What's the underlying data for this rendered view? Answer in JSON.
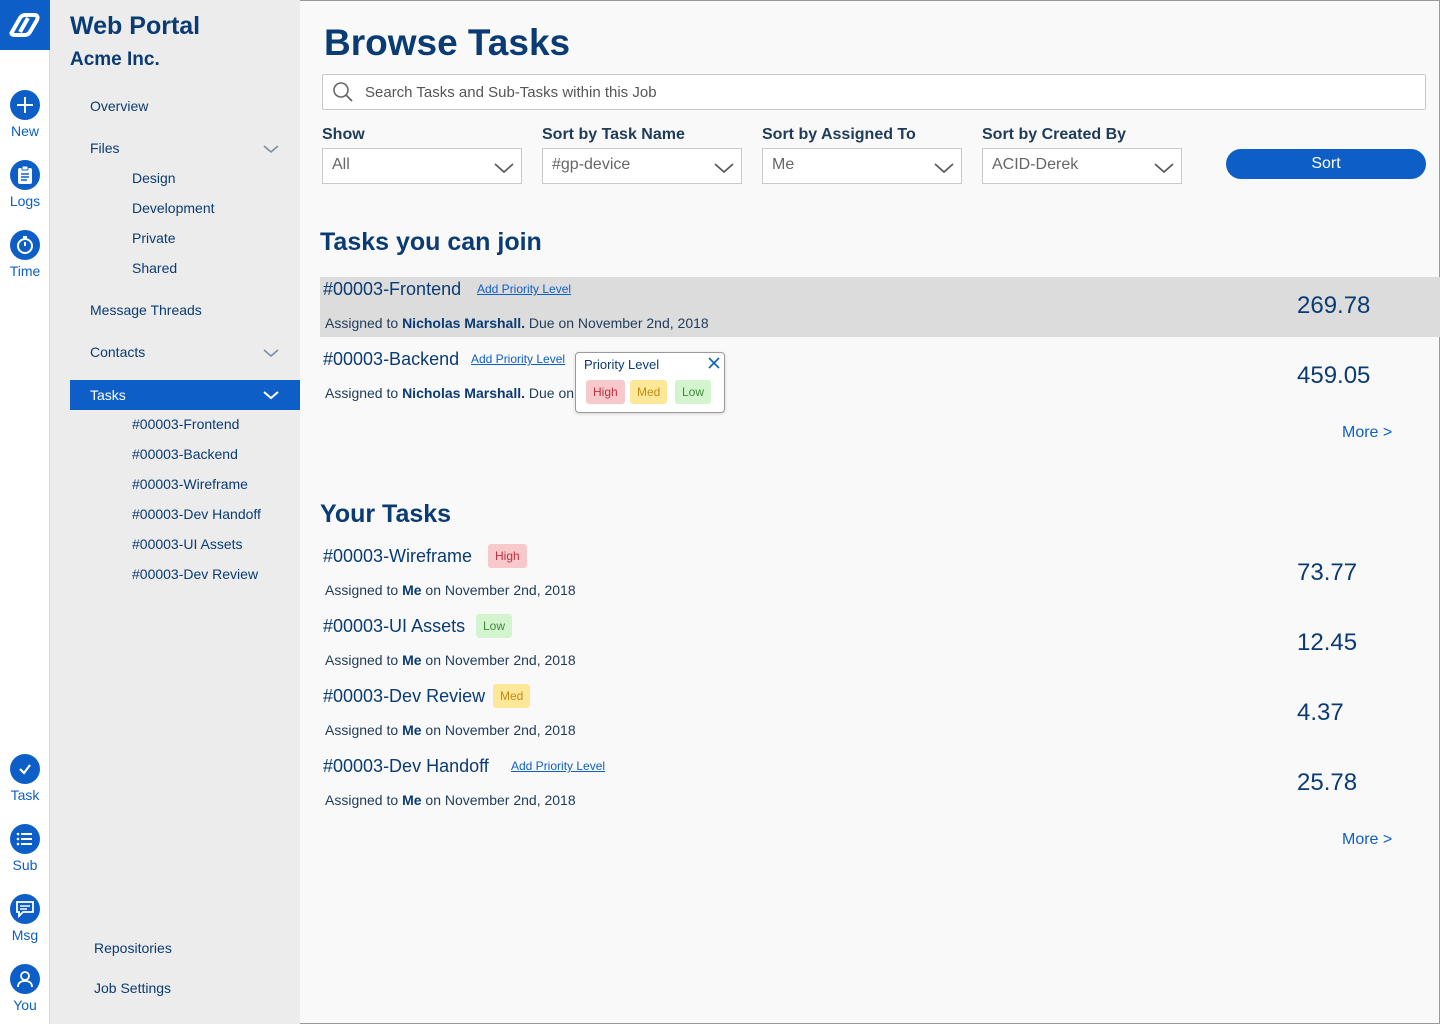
{
  "rail": {
    "logo_icon": "portal-logo-icon",
    "top": [
      {
        "label": "New",
        "icon": "plus-icon"
      },
      {
        "label": "Logs",
        "icon": "clipboard-icon"
      },
      {
        "label": "Time",
        "icon": "stopwatch-icon"
      }
    ],
    "bottom": [
      {
        "label": "Task",
        "icon": "check-icon"
      },
      {
        "label": "Sub",
        "icon": "list-icon"
      },
      {
        "label": "Msg",
        "icon": "chat-icon"
      },
      {
        "label": "You",
        "icon": "user-icon"
      }
    ]
  },
  "sidebar": {
    "title": "Web Portal",
    "subtitle": "Acme Inc.",
    "overview": "Overview",
    "files": {
      "label": "Files",
      "children": [
        "Design",
        "Development",
        "Private",
        "Shared"
      ]
    },
    "message_threads": "Message Threads",
    "contacts": "Contacts",
    "tasks": {
      "label": "Tasks",
      "children": [
        "#00003-Frontend",
        "#00003-Backend",
        "#00003-Wireframe",
        "#00003-Dev Handoff",
        "#00003-UI Assets",
        "#00003-Dev Review"
      ]
    },
    "repositories": "Repositories",
    "job_settings": "Job Settings"
  },
  "main": {
    "title": "Browse Tasks",
    "search_placeholder": "Search Tasks and Sub-Tasks within this Job",
    "filters": [
      {
        "label": "Show",
        "value": "All"
      },
      {
        "label": "Sort by Task Name",
        "value": "#gp-device"
      },
      {
        "label": "Sort by Assigned To",
        "value": "Me"
      },
      {
        "label": "Sort by Created By",
        "value": "ACID-Derek"
      }
    ],
    "sort_label": "Sort",
    "joinable": {
      "heading": "Tasks you can join",
      "tasks": [
        {
          "name": "#00003-Frontend",
          "add_priority": "Add Priority Level",
          "assigned_prefix": "Assigned to ",
          "assignee": "Nicholas Marshall.",
          "due": " Due on November 2nd, 2018",
          "value": "269.78"
        },
        {
          "name": "#00003-Backend",
          "add_priority": "Add Priority Level",
          "assigned_prefix": "Assigned to ",
          "assignee": "Nicholas Marshall.",
          "due": " Due on November 2nd, 2018",
          "value": "459.05"
        }
      ],
      "more": "More >"
    },
    "popover": {
      "title": "Priority Level",
      "high": "High",
      "med": "Med",
      "low": "Low"
    },
    "yours": {
      "heading": "Your Tasks",
      "tasks": [
        {
          "name": "#00003-Wireframe",
          "priority": "High",
          "assigned_prefix": "Assigned to ",
          "assignee": "Me",
          "due": " on November 2nd, 2018",
          "value": "73.77"
        },
        {
          "name": "#00003-UI Assets",
          "priority": "Low",
          "assigned_prefix": "Assigned to ",
          "assignee": "Me",
          "due": " on November 2nd, 2018",
          "value": "12.45"
        },
        {
          "name": "#00003-Dev Review",
          "priority": "Med",
          "assigned_prefix": "Assigned to ",
          "assignee": "Me",
          "due": " on November 2nd, 2018",
          "value": "4.37"
        },
        {
          "name": "#00003-Dev Handoff",
          "add_priority": "Add Priority Level",
          "assigned_prefix": "Assigned to ",
          "assignee": "Me",
          "due": " on November 2nd, 2018",
          "value": "25.78"
        }
      ],
      "more": "More >"
    }
  },
  "colors": {
    "brand": "#0d5fc7",
    "navy": "#0a3b73",
    "high_bg": "#f7c9cc",
    "med_bg": "#fde89a",
    "low_bg": "#d3f4cf"
  }
}
